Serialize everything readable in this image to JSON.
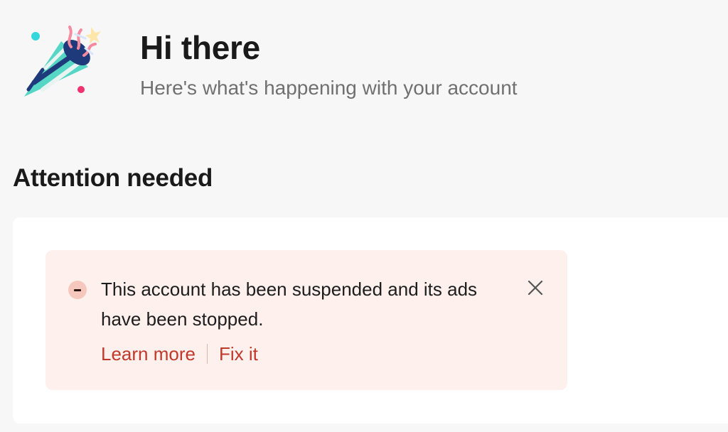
{
  "header": {
    "icon": "party-popper-icon",
    "title": "Hi there",
    "subtitle": "Here's what's happening with your account"
  },
  "section": {
    "title": "Attention needed"
  },
  "alert": {
    "status": "error",
    "status_icon": "minus-circle-icon",
    "close_icon": "close-icon",
    "message": "This account has been suspended and its ads have been stopped.",
    "links": [
      {
        "label": "Learn more"
      },
      {
        "label": "Fix it"
      }
    ],
    "colors": {
      "background": "#fdf0ed",
      "link": "#c0392b",
      "icon_bg": "#f6c8bd"
    }
  }
}
